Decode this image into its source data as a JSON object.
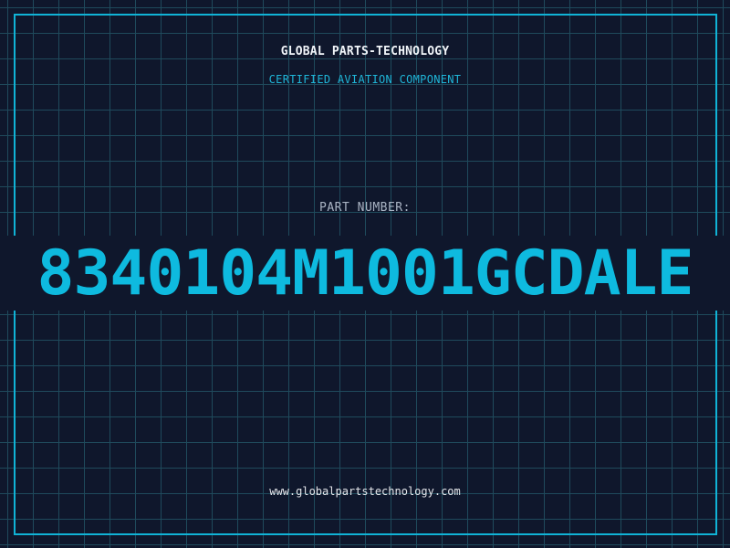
{
  "header": {
    "brand": "GLOBAL PARTS-TECHNOLOGY",
    "subtitle": "CERTIFIED AVIATION COMPONENT"
  },
  "part": {
    "label": "PART NUMBER:",
    "number": "8340104M1001GCDALE"
  },
  "footer": {
    "website": "www.globalpartstechnology.com"
  },
  "colors": {
    "background": "#0f172c",
    "grid": "#1f4a5c",
    "accent": "#0ebadf",
    "frame": "#10b3d6",
    "text_primary": "#f1f5f9",
    "text_muted": "#aab4c4"
  }
}
